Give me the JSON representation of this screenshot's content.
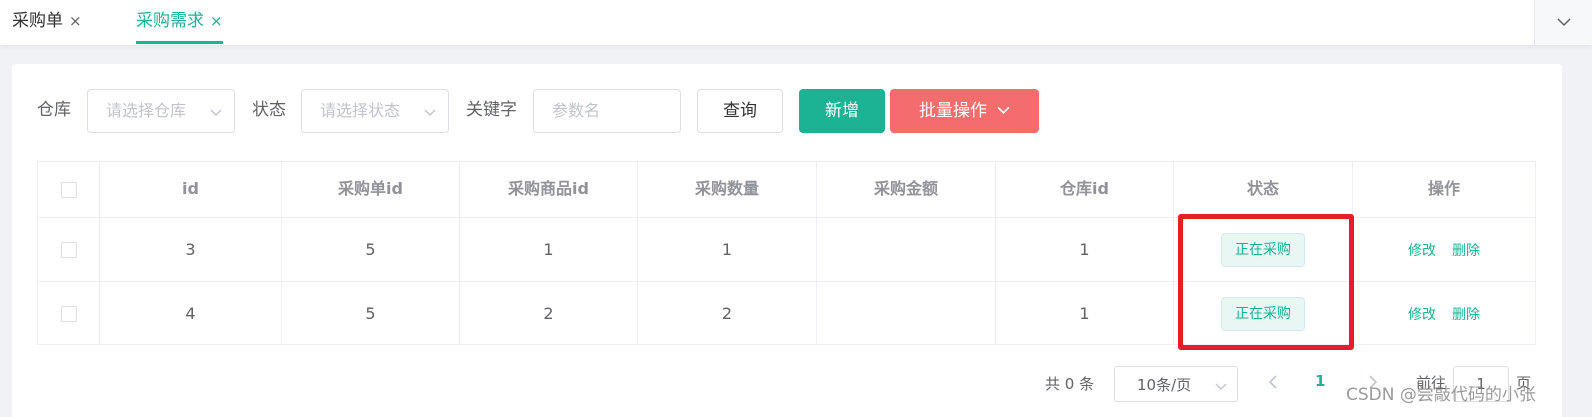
{
  "tabs": [
    {
      "label": "采购单",
      "close": "×"
    },
    {
      "label": "采购需求",
      "close": "×"
    }
  ],
  "filters": {
    "warehouse_label": "仓库",
    "warehouse_placeholder": "请选择仓库",
    "status_label": "状态",
    "status_placeholder": "请选择状态",
    "keyword_label": "关键字",
    "keyword_placeholder": "参数名"
  },
  "buttons": {
    "query": "查询",
    "add": "新增",
    "batch": "批量操作"
  },
  "table": {
    "columns": [
      "id",
      "采购单id",
      "采购商品id",
      "采购数量",
      "采购金额",
      "仓库id",
      "状态",
      "操作"
    ],
    "rows": [
      {
        "id": "3",
        "order_id": "5",
        "product_id": "1",
        "quantity": "1",
        "amount": "",
        "warehouse_id": "1",
        "status": "正在采购",
        "edit": "修改",
        "delete": "删除"
      },
      {
        "id": "4",
        "order_id": "5",
        "product_id": "2",
        "quantity": "2",
        "amount": "",
        "warehouse_id": "1",
        "status": "正在采购",
        "edit": "修改",
        "delete": "删除"
      }
    ]
  },
  "pagination": {
    "total": "共 0 条",
    "page_size": "10条/页",
    "current_page": "1",
    "goto_label": "前往",
    "goto_value": "1",
    "page_suffix": "页"
  },
  "watermark": "CSDN @尝敲代码的小张",
  "colors": {
    "accent": "#1bb394",
    "danger": "#f56c6c",
    "highlight_box": "#e61e28"
  }
}
